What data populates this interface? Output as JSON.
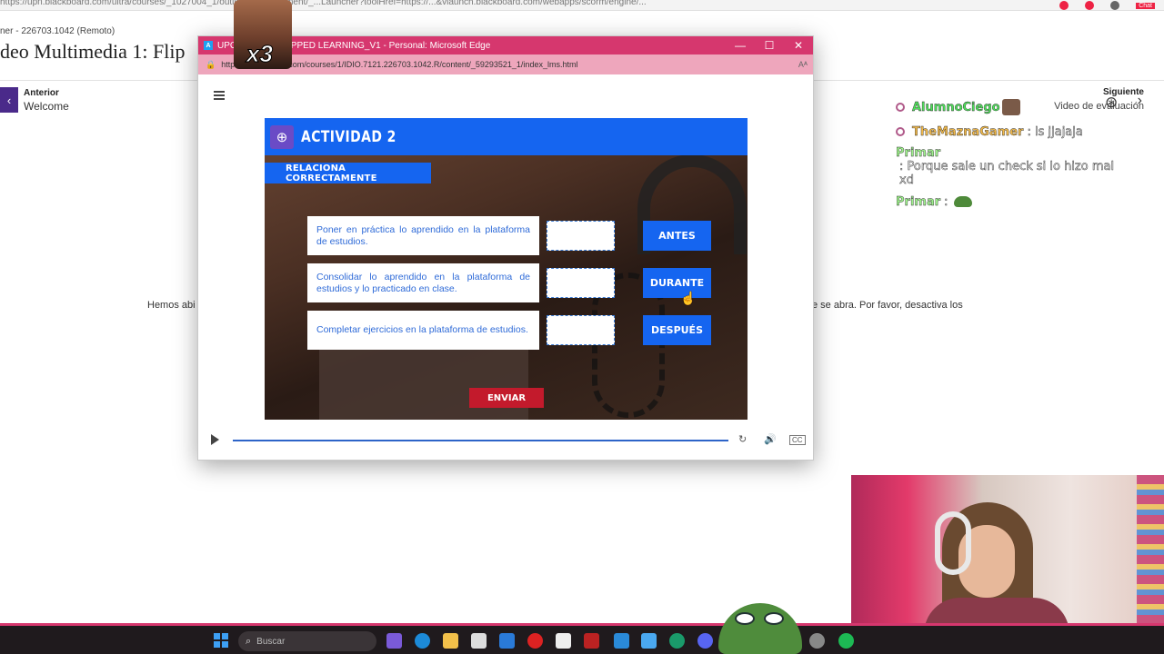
{
  "background": {
    "url_text": "https://upn.blackboard.com/ultra/courses/_1027004_1/outline/edit/document/_...Launcher?toolHref=https://...&vlaunch.blackboard.com/webapps/scorm/engine/...",
    "course_text": "ner - 226703.1042 (Remoto)",
    "page_title": "deo Multimedia 1: Flip",
    "prev_label": "Anterior",
    "prev_value": "Welcome",
    "next_label": "Siguiente",
    "next_value": "Video de evaluación",
    "notice_left": "Hemos abi",
    "notice_right": "e se abra. Por favor, desactiva los",
    "chat_label": "Chat"
  },
  "overlay": {
    "emote_counter": "x3"
  },
  "popup": {
    "title": "UPC_I     TA1_FLIPPED LEARNING_V1 - Personal: Microsoft Edge",
    "url": "https://     ckboard.com/courses/1/IDIO.7121.226703.1042.R/content/_59293521_1/index_lms.html",
    "icon_letter": "A",
    "minimize": "—",
    "maximize": "☐",
    "close": "✕",
    "reader_icon": "Aᴬ",
    "lock_icon": "🔒"
  },
  "activity": {
    "title": "ACTIVIDAD 2",
    "subtitle": "RELACIONA CORRECTAMENTE",
    "statements": [
      "Poner en práctica lo aprendido en la plataforma de estudios.",
      "Consolidar lo aprendido en la plataforma de estudios y lo practicado en clase.",
      "Completar ejercicios en la plataforma de estudios."
    ],
    "options": [
      "ANTES",
      "DURANTE",
      "DESPUÉS"
    ],
    "submit_label": "ENVIAR"
  },
  "player": {
    "replay_icon": "↻",
    "volume_icon": "🔊",
    "cc_icon": "CC"
  },
  "chat": {
    "messages": [
      {
        "user": "AlumnoCiego",
        "text": ""
      },
      {
        "user": "TheMaznaGamer",
        "text": ": ls jjajaja"
      },
      {
        "user": "Primar",
        "text": ": Porque sale un check si lo hizo mal xd"
      },
      {
        "user": "Primar",
        "text": ":"
      }
    ]
  },
  "taskbar": {
    "search_placeholder": "Buscar"
  }
}
